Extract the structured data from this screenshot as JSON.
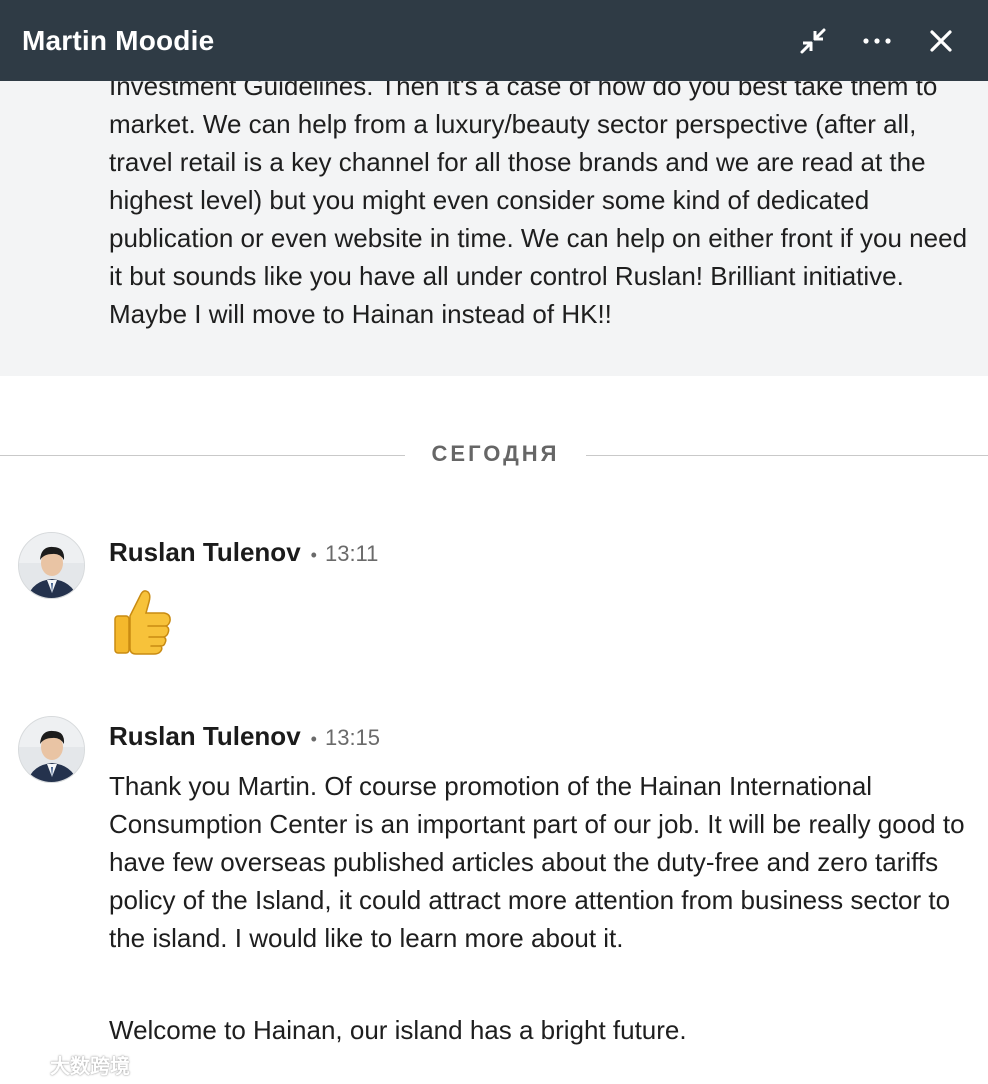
{
  "header": {
    "title": "Martin Moodie",
    "icons": [
      "collapse-icon",
      "more-icon",
      "close-icon"
    ]
  },
  "quoted_message": {
    "text": "Investment Guidelines. Then it's a case of how do you best take them to market. We can help from a luxury/beauty sector perspective (after all, travel retail is a key channel for all those brands and we are read at the highest level) but you might even consider some kind of dedicated publication or even website in time. We can help on either front if you need it but sounds like you have all under control Ruslan! Brilliant initiative. Maybe I will move to Hainan instead of HK!!"
  },
  "divider": {
    "label": "СЕГОДНЯ"
  },
  "messages": [
    {
      "sender": "Ruslan Tulenov",
      "separator": "•",
      "time": "13:11",
      "content": "thumbs-up-emoji"
    },
    {
      "sender": "Ruslan Tulenov",
      "separator": "•",
      "time": "13:15",
      "paragraphs": [
        "Thank you Martin. Of course promotion of the Hainan International Consumption Center is an important part of our job. It will be really good to have few overseas published articles about the duty-free and zero tariffs policy of the Island, it could attract more attention from business sector to the island. I would like to learn more about it.",
        "Welcome to Hainan, our island has a bright future."
      ]
    }
  ],
  "watermark": {
    "text": "大数跨境"
  },
  "colors": {
    "header_bg": "#2f3b45",
    "quoted_bg": "#f3f4f5",
    "divider_line": "#c9c9c9",
    "meta_text": "#6a6a6a"
  }
}
